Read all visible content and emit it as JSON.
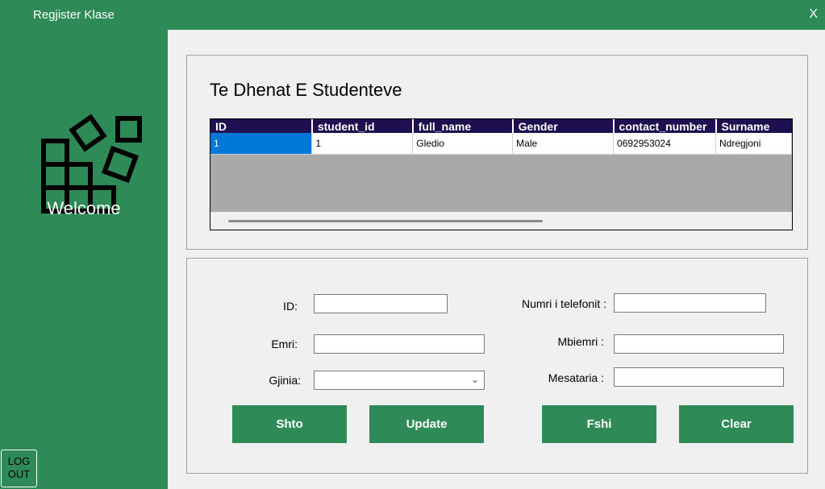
{
  "window": {
    "title": "Regjister Klase",
    "close_label": "X"
  },
  "sidebar": {
    "welcome": "Welcome",
    "logout_line1": "LOG",
    "logout_line2": "OUT"
  },
  "table_panel": {
    "heading": "Te Dhenat E Studenteve",
    "columns": [
      "ID",
      "student_id",
      "full_name",
      "Gender",
      "contact_number",
      "Surname"
    ],
    "rows": [
      [
        "1",
        "1",
        "Gledio",
        "Male",
        "0692953024",
        "Ndregjoni"
      ]
    ]
  },
  "form": {
    "id_label": "ID:",
    "emri_label": "Emri:",
    "gjinia_label": "Gjinia:",
    "telefon_label": "Numri i telefonit :",
    "mbiemri_label": "Mbiemri :",
    "mesataria_label": "Mesataria :",
    "id_value": "",
    "emri_value": "",
    "gjinia_value": "",
    "telefon_value": "",
    "mbiemri_value": "",
    "mesataria_value": ""
  },
  "buttons": {
    "shto": "Shto",
    "update": "Update",
    "fshi": "Fshi",
    "clear": "Clear"
  },
  "colors": {
    "accent": "#2e8b57",
    "header_bg": "#1e1050",
    "selected": "#0078d7"
  }
}
